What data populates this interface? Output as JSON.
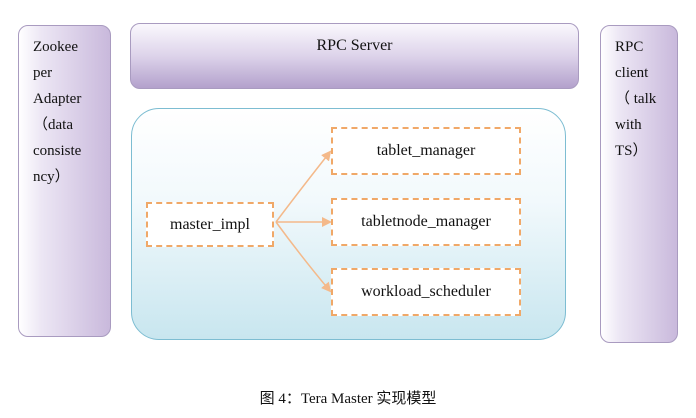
{
  "left_panel": {
    "lines": [
      "Zookee",
      "per",
      "Adapter",
      "（data",
      "consiste",
      "ncy）"
    ]
  },
  "rpc_server": {
    "label": "RPC Server"
  },
  "right_panel": {
    "lines": [
      "RPC",
      "client",
      "（ talk",
      "with",
      "TS）"
    ]
  },
  "master": {
    "impl_label": "master_impl",
    "components": [
      "tablet_manager",
      "tabletnode_manager",
      "workload_scheduler"
    ]
  },
  "caption": "图 4：Tera Master 实现模型",
  "colors": {
    "arrow": "#f4b98a",
    "dashed_border": "#f0a868",
    "panel_border": "#a99bc0",
    "container_border": "#7dbdd2"
  }
}
